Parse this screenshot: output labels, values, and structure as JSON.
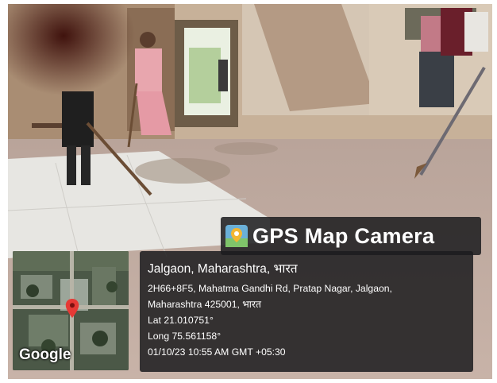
{
  "stamp": {
    "title": "GPS Map Camera",
    "logo_icon": "map-pin-app-icon"
  },
  "map": {
    "provider": "Google",
    "marker_icon": "map-pin-icon"
  },
  "location": {
    "place": "Jalgaon, Maharashtra, भारत",
    "address_line_1": "2H66+8F5, Mahatma Gandhi Rd, Pratap Nagar, Jalgaon,",
    "address_line_2": "Maharashtra 425001, भारत",
    "latitude": "Lat 21.010751°",
    "longitude": "Long 75.561158°",
    "datetime": "01/10/23 10:55 AM GMT +05:30"
  },
  "colors": {
    "overlay": "#1c1c1e",
    "marker": "#e53935",
    "text": "#ffffff"
  }
}
